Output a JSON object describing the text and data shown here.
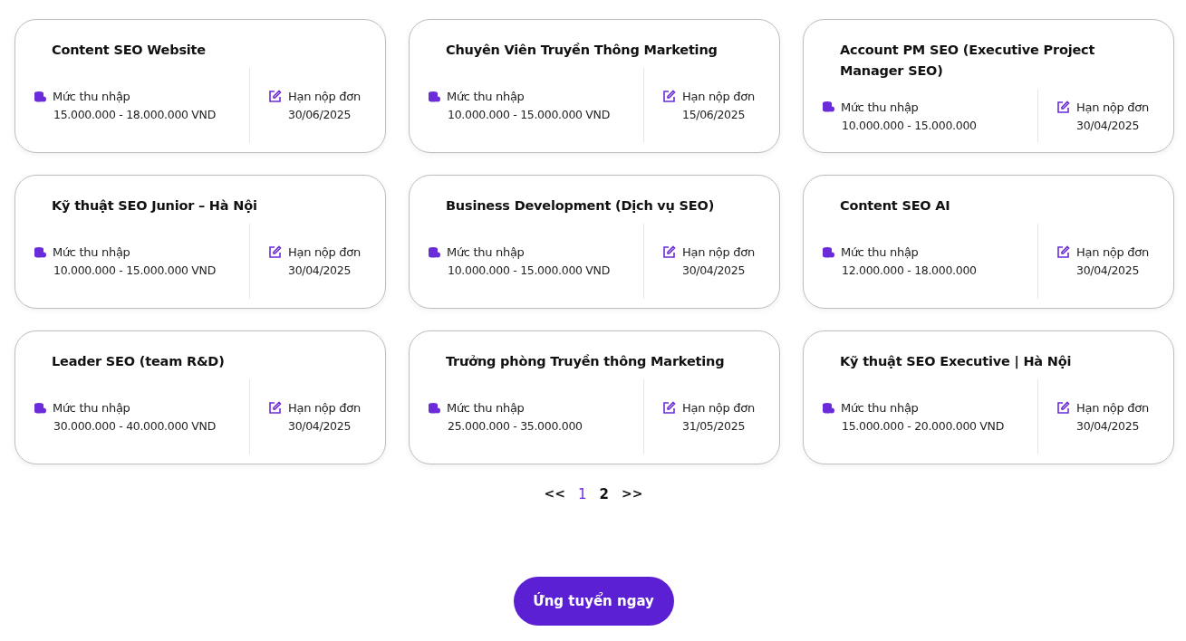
{
  "jobs": [
    {
      "title": "Content SEO Website",
      "salary_label": "Mức thu nhập",
      "salary": "15.000.000 - 18.000.000 VND",
      "deadline_label": "Hạn nộp đơn",
      "deadline": "30/06/2025"
    },
    {
      "title": "Chuyên Viên Truyền Thông Marketing",
      "salary_label": "Mức thu nhập",
      "salary": "10.000.000 - 15.000.000 VND",
      "deadline_label": "Hạn nộp đơn",
      "deadline": "15/06/2025"
    },
    {
      "title": "Account PM SEO (Executive Project Manager SEO)",
      "salary_label": "Mức thu nhập",
      "salary": "10.000.000 - 15.000.000",
      "deadline_label": "Hạn nộp đơn",
      "deadline": "30/04/2025"
    },
    {
      "title": "Kỹ thuật SEO Junior – Hà Nội",
      "salary_label": "Mức thu nhập",
      "salary": "10.000.000 - 15.000.000 VND",
      "deadline_label": "Hạn nộp đơn",
      "deadline": "30/04/2025"
    },
    {
      "title": "Business Development (Dịch vụ SEO)",
      "salary_label": "Mức thu nhập",
      "salary": "10.000.000 - 15.000.000 VND",
      "deadline_label": "Hạn nộp đơn",
      "deadline": "30/04/2025"
    },
    {
      "title": "Content SEO AI",
      "salary_label": "Mức thu nhập",
      "salary": "12.000.000 - 18.000.000",
      "deadline_label": "Hạn nộp đơn",
      "deadline": "30/04/2025"
    },
    {
      "title": "Leader SEO (team R&D)",
      "salary_label": "Mức thu nhập",
      "salary": "30.000.000 - 40.000.000 VND",
      "deadline_label": "Hạn nộp đơn",
      "deadline": "30/04/2025"
    },
    {
      "title": "Trưởng phòng Truyền thông Marketing",
      "salary_label": "Mức thu nhập",
      "salary": "25.000.000 - 35.000.000",
      "deadline_label": "Hạn nộp đơn",
      "deadline": "31/05/2025"
    },
    {
      "title": "Kỹ thuật SEO Executive | Hà Nội",
      "salary_label": "Mức thu nhập",
      "salary": "15.000.000 - 20.000.000 VND",
      "deadline_label": "Hạn nộp đơn",
      "deadline": "30/04/2025"
    }
  ],
  "pagination": {
    "prev": "<<",
    "pages": [
      {
        "label": "1",
        "selected": true
      },
      {
        "label": "2",
        "selected": false
      }
    ],
    "next": ">>"
  },
  "apply_button": "Ứng tuyển ngay"
}
